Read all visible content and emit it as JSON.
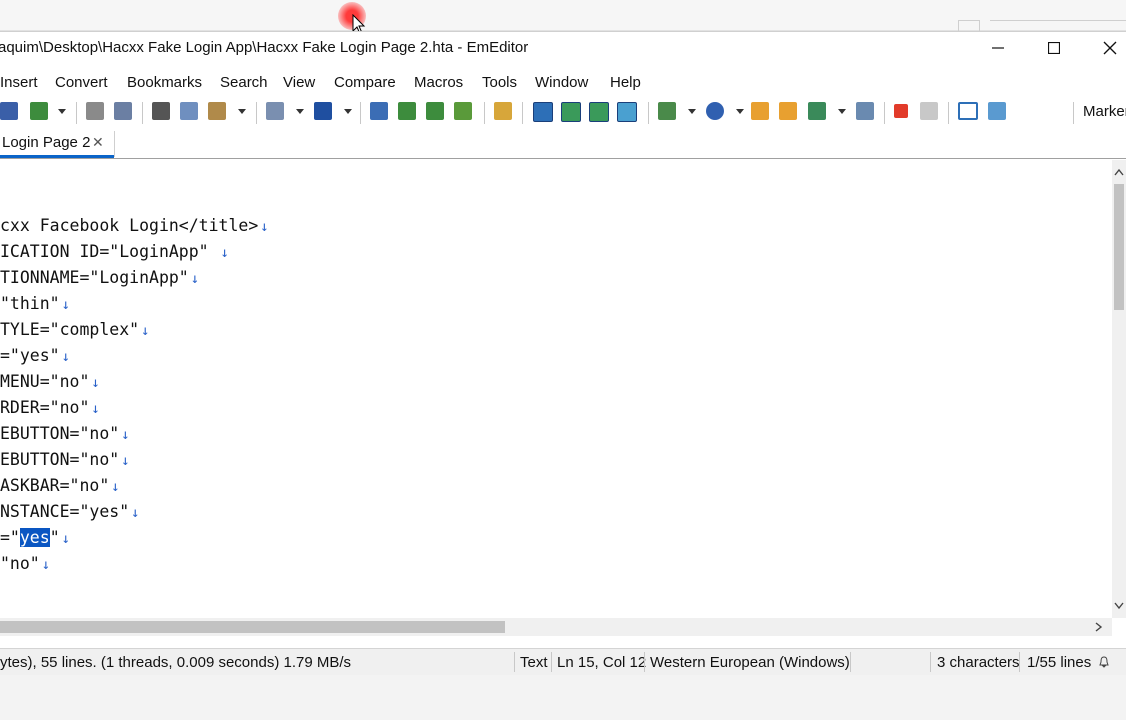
{
  "window": {
    "title": "aquim\\Desktop\\Hacxx Fake Login App\\Hacxx Fake Login Page 2.hta - EmEditor"
  },
  "menu": [
    "Insert",
    "Convert",
    "Bookmarks",
    "Search",
    "View",
    "Compare",
    "Macros",
    "Tools",
    "Window",
    "Help"
  ],
  "toolbar": {
    "marker_label": "Marker"
  },
  "tab": {
    "label": "Login Page 2",
    "close": "✕"
  },
  "editor": {
    "newline_glyph": "↓",
    "lines": [
      "cxx Facebook Login</title>",
      "ICATION ID=\"LoginApp\" ",
      "TIONNAME=\"LoginApp\"",
      "\"thin\"",
      "TYLE=\"complex\"",
      "=\"yes\"",
      "MENU=\"no\"",
      "RDER=\"no\"",
      "EBUTTON=\"no\"",
      "EBUTTON=\"no\"",
      "ASKBAR=\"no\"",
      "NSTANCE=\"yes\""
    ],
    "selected_line": {
      "before": "=\"",
      "selected": "yes",
      "after": "\""
    },
    "last_line": "\"no\""
  },
  "status": {
    "info": "ytes), 55 lines. (1 threads, 0.009 seconds) 1.79 MB/s",
    "mode": "Text",
    "position": "Ln 15, Col 12",
    "encoding": "Western European (Windows)",
    "selection": "3 characters",
    "lines": "1/55 lines"
  },
  "colors": {
    "selection": "#0a56c2",
    "newline_mark": "#2a62c9",
    "tab_accent": "#0a64c8"
  }
}
